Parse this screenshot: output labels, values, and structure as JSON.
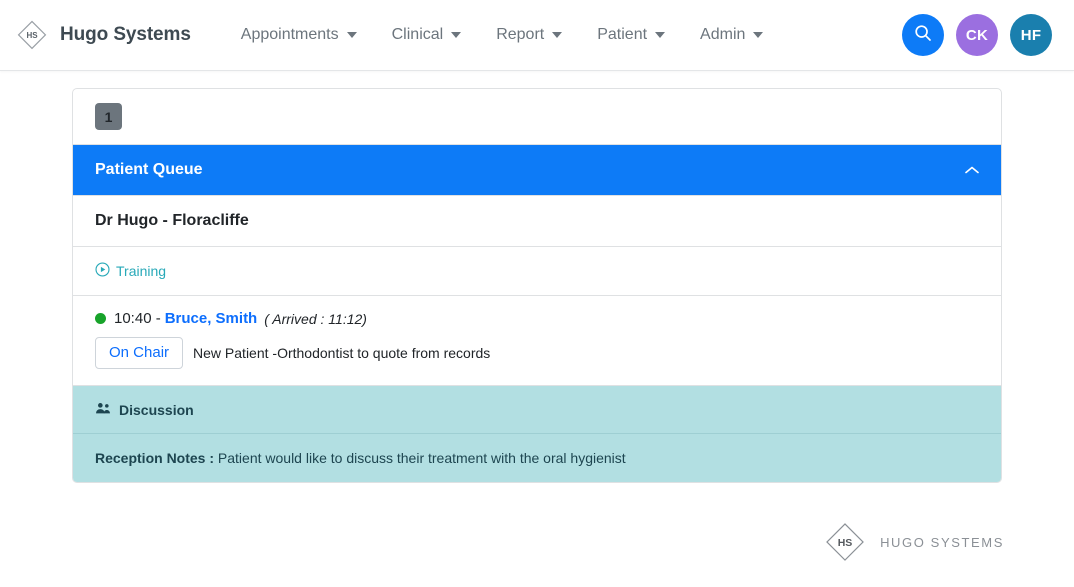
{
  "navbar": {
    "brand": {
      "logo_icon": "hugo-diamond-logo",
      "logo_initials": "HS",
      "name": "Hugo Systems"
    },
    "menu_items": [
      {
        "label": "Appointments",
        "icon": "chevron-down-icon"
      },
      {
        "label": "Clinical",
        "icon": "chevron-down-icon"
      },
      {
        "label": "Report",
        "icon": "chevron-down-icon"
      },
      {
        "label": "Patient",
        "icon": "chevron-down-icon"
      },
      {
        "label": "Admin",
        "icon": "chevron-down-icon"
      }
    ],
    "actions": {
      "search": {
        "icon": "search-icon",
        "label": "",
        "color": "#0d7bf7"
      },
      "avatar_1": {
        "initials": "CK",
        "color": "#9b6fe0"
      },
      "avatar_2": {
        "initials": "HF",
        "color": "#1a7fae"
      }
    }
  },
  "main": {
    "pager": {
      "current_page": "1"
    },
    "queue": {
      "title": "Patient Queue",
      "collapse_icon": "chevron-up-icon",
      "header_color": "#0d7bf7",
      "provider": "Dr Hugo - Floracliffe",
      "training": {
        "icon": "play-circle-icon",
        "label": "Training",
        "color": "#28a9b8"
      },
      "patients": [
        {
          "status_icon": "status-dot-green",
          "status_color": "#18a32a",
          "time": "10:40 - ",
          "name": "Bruce, Smith",
          "arrived": "( Arrived : 11:12)",
          "state_button": "On Chair",
          "note": "New Patient -Orthodontist to quote from records"
        }
      ],
      "discussion": {
        "icon": "users-icon",
        "label": "Discussion",
        "background": "#b2dfe2"
      },
      "reception_notes": {
        "label": "Reception Notes :",
        "text": "Patient would like to discuss their treatment with the oral hygienist"
      }
    }
  },
  "footer": {
    "logo_icon": "hugo-diamond-logo",
    "logo_initials": "HS",
    "text": "HUGO SYSTEMS"
  }
}
